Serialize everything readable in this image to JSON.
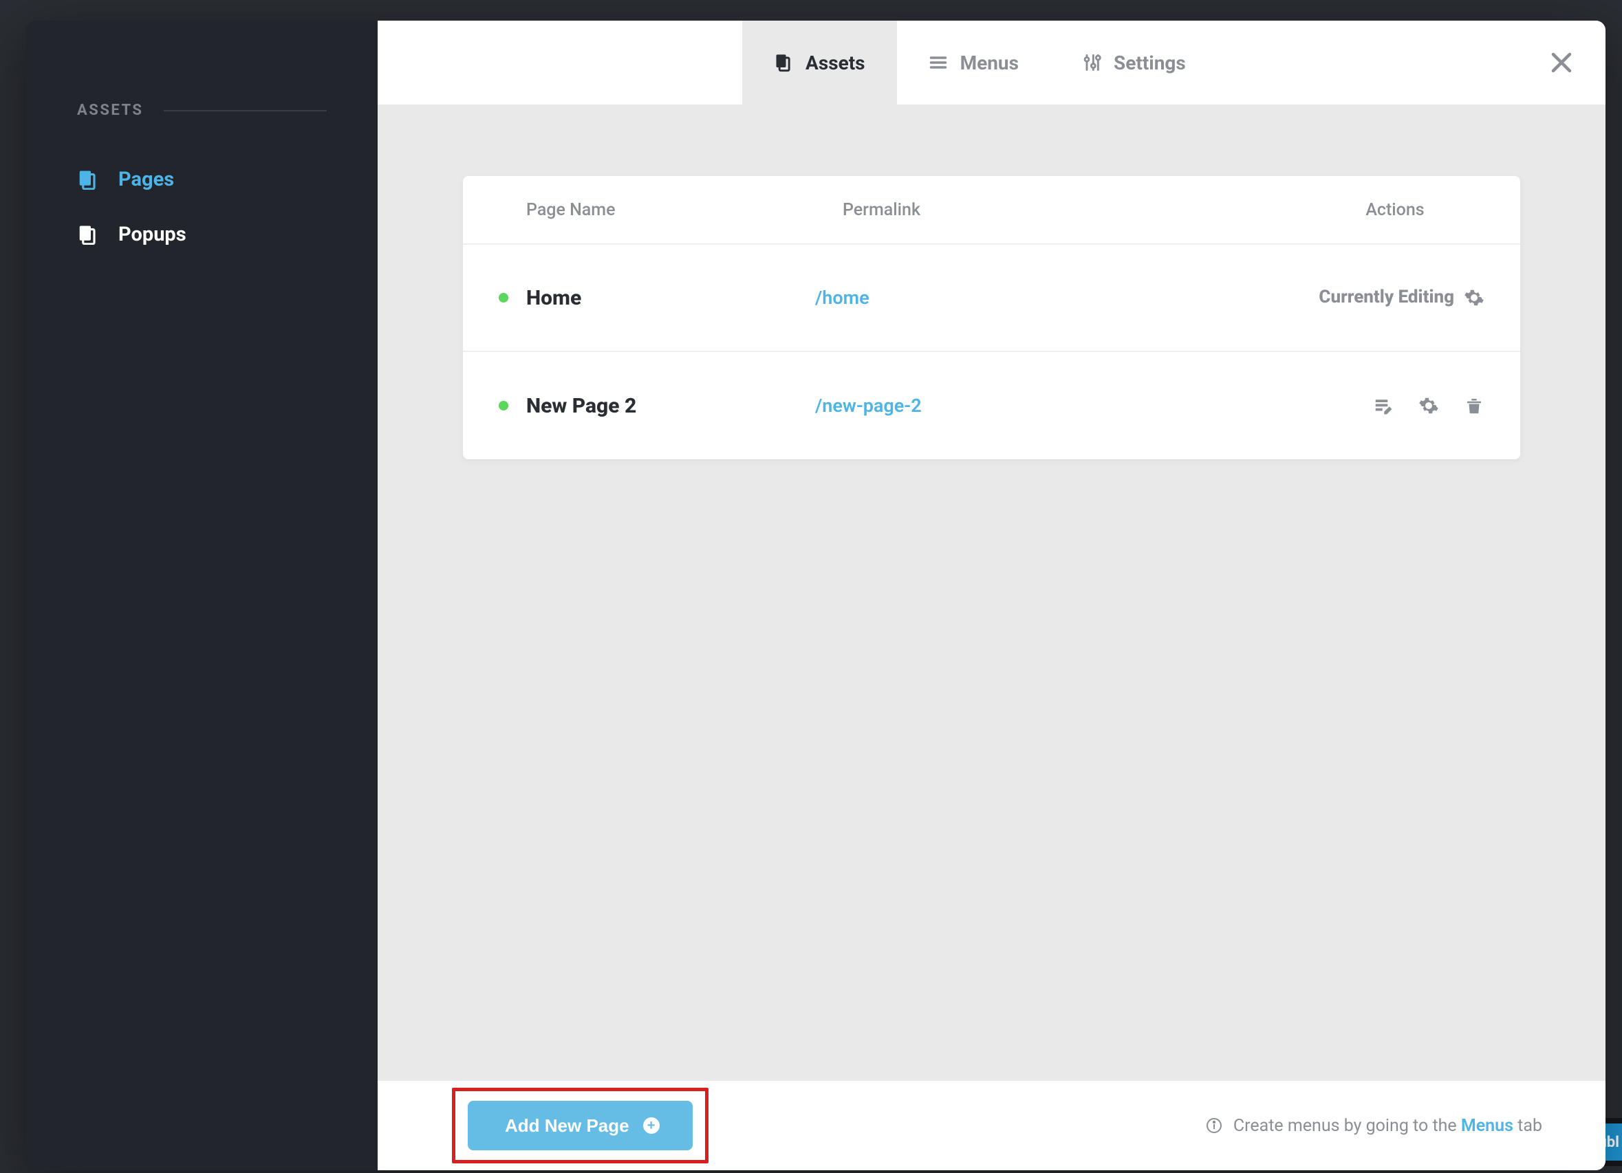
{
  "sidebar": {
    "section_title": "ASSETS",
    "items": [
      {
        "label": "Pages",
        "active": true
      },
      {
        "label": "Popups",
        "active": false
      }
    ]
  },
  "tabs": [
    {
      "label": "Assets",
      "active": true
    },
    {
      "label": "Menus",
      "active": false
    },
    {
      "label": "Settings",
      "active": false
    }
  ],
  "table": {
    "headers": {
      "name": "Page Name",
      "link": "Permalink",
      "actions": "Actions"
    },
    "rows": [
      {
        "name": "Home",
        "permalink": "/home",
        "status_color": "#5bd75b",
        "editing": true,
        "editing_label": "Currently Editing"
      },
      {
        "name": "New Page 2",
        "permalink": "/new-page-2",
        "status_color": "#5bd75b",
        "editing": false
      }
    ]
  },
  "footer": {
    "add_label": "Add New Page",
    "hint_prefix": "Create menus by going to the ",
    "hint_link": "Menus",
    "hint_suffix": " tab"
  },
  "bg_toolbar": {
    "publish_fragment": "ubl"
  },
  "colors": {
    "accent": "#4cb4e7",
    "button": "#65bde6",
    "highlight_border": "#d7201f",
    "status_green": "#5bd75b"
  }
}
